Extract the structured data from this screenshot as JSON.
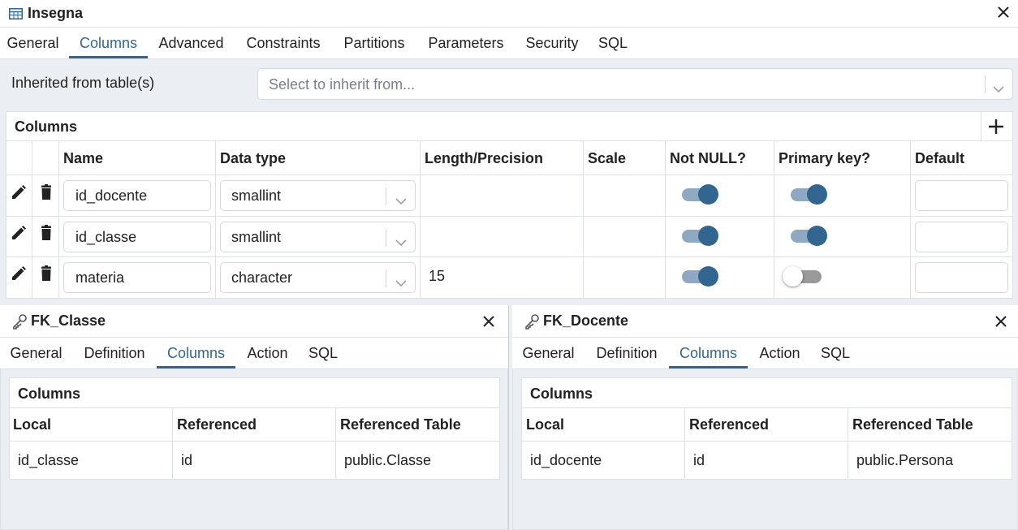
{
  "window": {
    "title": "Insegna",
    "icon": "table-icon",
    "close_icon": "close-icon"
  },
  "tabs": [
    "General",
    "Columns",
    "Advanced",
    "Constraints",
    "Partitions",
    "Parameters",
    "Security",
    "SQL"
  ],
  "active_tab": "Columns",
  "inherit": {
    "label": "Inherited from table(s)",
    "placeholder": "Select to inherit from..."
  },
  "columns_panel": {
    "title": "Columns",
    "add_icon": "plus-icon",
    "headers": [
      "Name",
      "Data type",
      "Length/Precision",
      "Scale",
      "Not NULL?",
      "Primary key?",
      "Default"
    ],
    "rows": [
      {
        "name": "id_docente",
        "type": "smallint",
        "length": "",
        "scale": "",
        "not_null": true,
        "primary_key": true,
        "default": ""
      },
      {
        "name": "id_classe",
        "type": "smallint",
        "length": "",
        "scale": "",
        "not_null": true,
        "primary_key": true,
        "default": ""
      },
      {
        "name": "materia",
        "type": "character",
        "length": "15",
        "scale": "",
        "not_null": true,
        "primary_key": false,
        "default": ""
      }
    ]
  },
  "fk_left": {
    "title": "FK_Classe",
    "icon": "key-icon",
    "tabs": [
      "General",
      "Definition",
      "Columns",
      "Action",
      "SQL"
    ],
    "active_tab": "Columns",
    "table_title": "Columns",
    "headers": [
      "Local",
      "Referenced",
      "Referenced Table"
    ],
    "rows": [
      {
        "local": "id_classe",
        "referenced": "id",
        "table": "public.Classe"
      }
    ]
  },
  "fk_right": {
    "title": "FK_Docente",
    "icon": "key-icon",
    "tabs": [
      "General",
      "Definition",
      "Columns",
      "Action",
      "SQL"
    ],
    "active_tab": "Columns",
    "table_title": "Columns",
    "headers": [
      "Local",
      "Referenced",
      "Referenced Table"
    ],
    "rows": [
      {
        "local": "id_docente",
        "referenced": "id",
        "table": "public.Persona"
      }
    ]
  },
  "colors": {
    "accent": "#326690",
    "toggle_track_on": "#8fa9c2",
    "border": "#dde0e6",
    "background": "#ebeef3"
  }
}
